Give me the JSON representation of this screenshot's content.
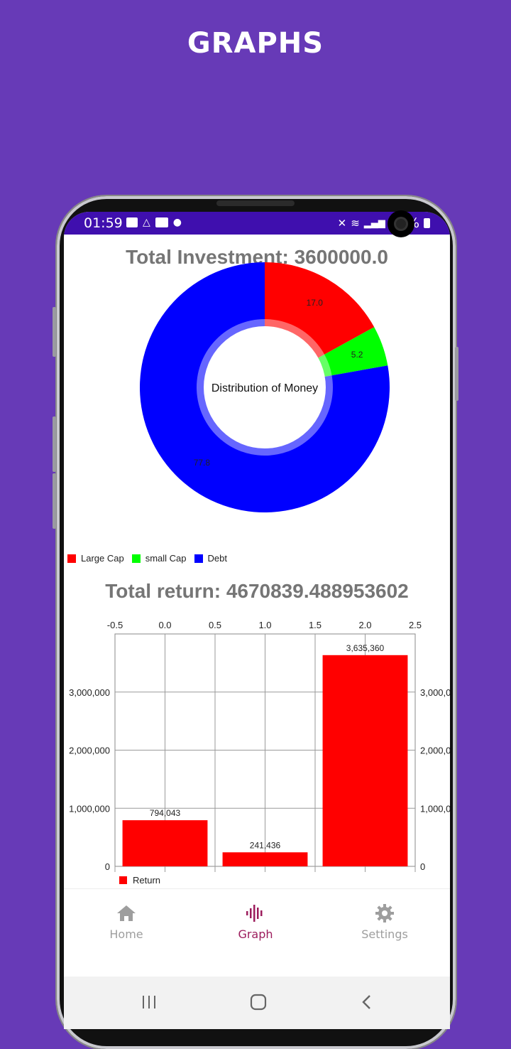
{
  "header": {
    "title": "GRAPHS"
  },
  "statusbar": {
    "time": "01:59",
    "battery": "66%"
  },
  "investment": {
    "label": "Total Investment: 3600000.0"
  },
  "pie": {
    "center_label": "Distribution of Money",
    "colors": {
      "large_cap": "#FF0000",
      "small_cap": "#00FF00",
      "debt": "#0000FF"
    },
    "legend": [
      "Large Cap",
      "small Cap",
      "Debt"
    ]
  },
  "returns": {
    "label": "Total return: 4670839.488953602"
  },
  "bar": {
    "legend": "Return",
    "color": "#FF0000"
  },
  "chart_data": [
    {
      "type": "pie",
      "categories": [
        "Large Cap",
        "small Cap",
        "Debt"
      ],
      "values": [
        17.0,
        5.2,
        77.8
      ],
      "value_labels": [
        "17.0",
        "5.2",
        "77.8"
      ],
      "center_text": "Distribution of Money",
      "legend_placement": "bottom-left"
    },
    {
      "type": "bar",
      "x": [
        0,
        1,
        2
      ],
      "values": [
        794043,
        241436,
        3635360
      ],
      "value_labels": [
        "794,043",
        "241,436",
        "3,635,360"
      ],
      "series": [
        {
          "name": "Return",
          "values": [
            794043,
            241436,
            3635360
          ]
        }
      ],
      "xlim": [
        -0.5,
        2.5
      ],
      "x_tick_labels": [
        "-0.5",
        "0.0",
        "0.5",
        "1.0",
        "1.5",
        "2.0",
        "2.5"
      ],
      "ylim": [
        0,
        4000000
      ],
      "y_tick_labels_left": [
        "0",
        "1,000,000",
        "2,000,000",
        "3,000,000"
      ],
      "y_tick_labels_right": [
        "0",
        "1,000,0",
        "2,000,0",
        "3,000,0"
      ],
      "grid": true,
      "legend_placement": "bottom-left"
    }
  ],
  "nav": {
    "items": [
      {
        "label": "Home",
        "icon": "home-icon"
      },
      {
        "label": "Graph",
        "icon": "graph-icon"
      },
      {
        "label": "Settings",
        "icon": "settings-icon"
      }
    ],
    "active_color": "#9C1C5C",
    "inactive_color": "#9E9E9E"
  }
}
